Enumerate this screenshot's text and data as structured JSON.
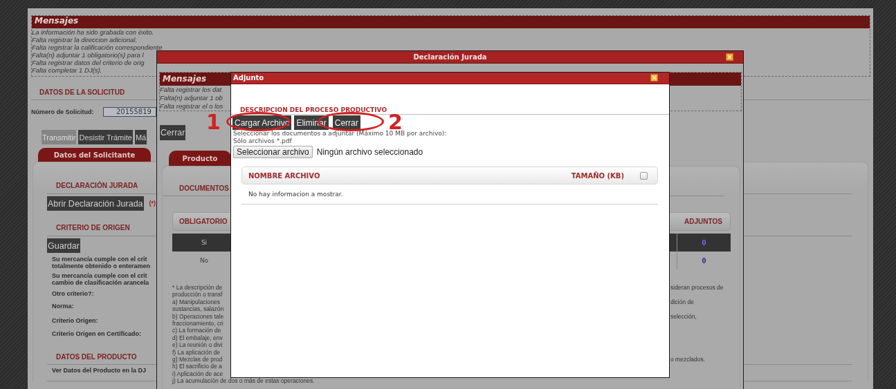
{
  "page": {
    "messages": {
      "title": "Mensajes",
      "lines": [
        "La información ha sido grabada con éxito.",
        "Falta registrar la direccion adicional.",
        "Falta registrar la calificación correspondiente",
        "Falta(n) adjuntar 1 obligatorio(s) para l",
        "Falta registrar datos del criterio de orig",
        "Falta completar 1 DJ(s)."
      ]
    },
    "solicitud": {
      "heading": "DATOS DE LA SOLICITUD",
      "number_label": "Número de Solicitud:",
      "number_value": "20155819"
    },
    "actions": [
      {
        "label": "Transmitir",
        "disabled": true
      },
      {
        "label": "Desistir Trámite",
        "disabled": false
      },
      {
        "label": "Má",
        "disabled": false
      }
    ],
    "tab": "Datos del Solicitante",
    "declaracion": {
      "heading": "DECLARACIÓN JURADA",
      "button": "Abrir Declaración Jurada",
      "required_mark": "(*)"
    },
    "criterio": {
      "heading": "CRITERIO DE ORIGEN",
      "button": "Guardar",
      "questions": [
        [
          "Su mercancía cumple con el crit",
          "totalmente obtenido o enteramen"
        ],
        [
          "Su mercancía cumple con el crit",
          "cambio de clasificación arancela"
        ]
      ],
      "fields": [
        "Otro criterio?:",
        "Norma:",
        "Criterio Origen:",
        "Criterio Origen en Certificado:"
      ]
    },
    "producto": {
      "heading": "DATOS DEL PRODUCTO",
      "link": "Ver Datos del Producto en la DJ"
    }
  },
  "dj_dialog": {
    "title": "Declaración Jurada",
    "messages": {
      "title": "Mensajes",
      "lines": [
        "Falta registrar los dat",
        "Falta(n) adjuntar 1 ob",
        "Falta registrar el o los"
      ]
    },
    "close_button": "Cerrar",
    "tab": "Producto",
    "section_heading": "DOCUMENTOS",
    "table": {
      "columns": [
        "OBLIGATORIO",
        "ADJUNTOS"
      ],
      "rows": [
        {
          "obligatorio": "Si",
          "adjuntos": "0",
          "selected": true
        },
        {
          "obligatorio": "No",
          "adjuntos": "0",
          "selected": false
        }
      ]
    },
    "notes": [
      {
        "left": "* La descripción de",
        "right": "sideran procesos de"
      },
      {
        "left": "producción o transf"
      },
      {
        "left": "a) Manipulaciones",
        "right": "dición de"
      },
      {
        "left": "sustancias, salazón"
      },
      {
        "left": "b) Operaciones tale",
        "right": "selección,"
      },
      {
        "left": "fraccionamiento, cri"
      },
      {
        "left": "c) La formación de"
      },
      {
        "left": "d) El embalaje, env"
      },
      {
        "left": "e) La reunión o divi"
      },
      {
        "left": "f) La aplicación de"
      },
      {
        "left": "g) Mezclas de prod",
        "right": "o mezclados."
      },
      {
        "left": "h) El sacrificio de a"
      },
      {
        "left": "i) Aplicación de ace"
      },
      {
        "left": "j) La acumulación de dos o más de estas operaciones."
      }
    ]
  },
  "adjunto_dialog": {
    "title": "Adjunto",
    "heading": "DESCRIPCION DEL PROCESO PRODUCTIVO",
    "buttons": [
      "Cargar Archivo",
      "Eliminar",
      "Cerrar"
    ],
    "instructions": "Seleccionar los documentos a adjuntar (Máximo 10 MB por archivo):",
    "file_types": "Sólo archivos *.pdf",
    "file_button": "Seleccionar archivo",
    "file_status": "Ningún archivo seleccionado",
    "table": {
      "columns": [
        "NOMBRE ARCHIVO",
        "TAMAÑO (KB)"
      ],
      "select_all_checked": false,
      "empty_message": "No hay informacion a mostrar."
    }
  },
  "annotations": [
    {
      "label": "1"
    },
    {
      "label": "2"
    }
  ]
}
